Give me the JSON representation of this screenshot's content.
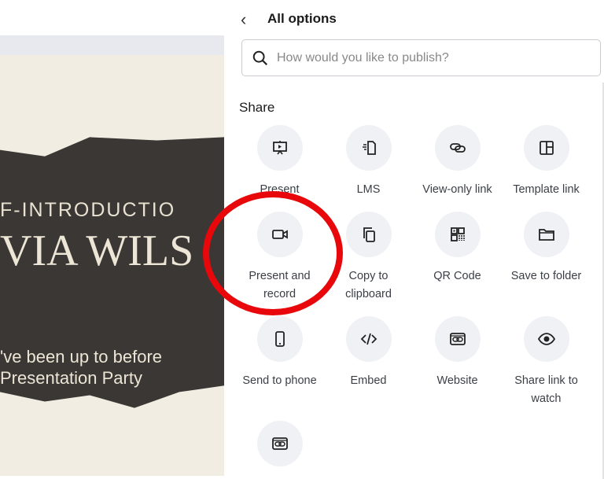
{
  "slide": {
    "line1": "F-INTRODUCTIO",
    "line2": "VIA WILS",
    "line3": "'ve been up to before",
    "line4": "Presentation Party"
  },
  "panel": {
    "title": "All options",
    "search_placeholder": "How would you like to publish?",
    "section": "Share",
    "items": [
      {
        "label": "Present",
        "icon": "presentation-icon"
      },
      {
        "label": "LMS",
        "icon": "lms-icon"
      },
      {
        "label": "View-only link",
        "icon": "link-icon"
      },
      {
        "label": "Template link",
        "icon": "template-icon"
      },
      {
        "label": "Present and record",
        "icon": "camera-icon"
      },
      {
        "label": "Copy to clipboard",
        "icon": "copy-icon"
      },
      {
        "label": "QR Code",
        "icon": "qr-code-icon"
      },
      {
        "label": "Save to folder",
        "icon": "folder-icon"
      },
      {
        "label": "Send to phone",
        "icon": "phone-icon"
      },
      {
        "label": "Embed",
        "icon": "code-icon"
      },
      {
        "label": "Website",
        "icon": "website-icon"
      },
      {
        "label": "Share link to watch",
        "icon": "eye-icon"
      },
      {
        "label": "",
        "icon": "website-icon"
      }
    ]
  },
  "annotation_color": "#e8080c"
}
